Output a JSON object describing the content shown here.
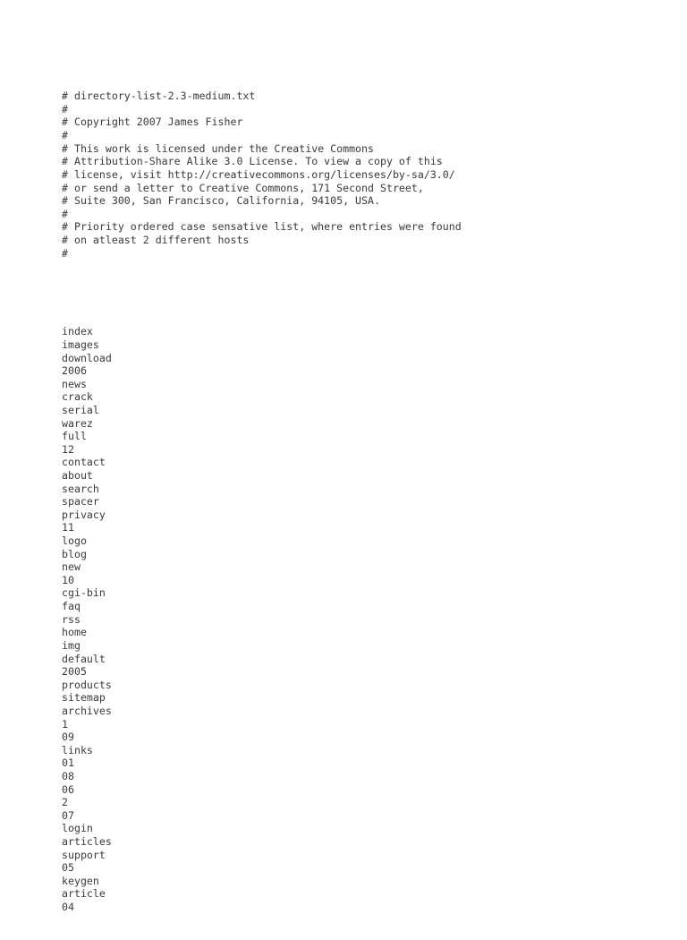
{
  "document": {
    "kind": "plain-text-file",
    "filename": "directory-list-2.3-medium.txt",
    "background_color": "#ffffff",
    "text_color": "#3a3a3a"
  },
  "header_comments": [
    "# directory-list-2.3-medium.txt",
    "#",
    "# Copyright 2007 James Fisher",
    "#",
    "# This work is licensed under the Creative Commons",
    "# Attribution-Share Alike 3.0 License. To view a copy of this",
    "# license, visit http://creativecommons.org/licenses/by-sa/3.0/",
    "# or send a letter to Creative Commons, 171 Second Street,",
    "# Suite 300, San Francisco, California, 94105, USA.",
    "#",
    "# Priority ordered case sensative list, where entries were found",
    "# on atleast 2 different hosts",
    "#"
  ],
  "separator_blank_lines": 1,
  "entries": [
    "index",
    "images",
    "download",
    "2006",
    "news",
    "crack",
    "serial",
    "warez",
    "full",
    "12",
    "contact",
    "about",
    "search",
    "spacer",
    "privacy",
    "11",
    "logo",
    "blog",
    "new",
    "10",
    "cgi-bin",
    "faq",
    "rss",
    "home",
    "img",
    "default",
    "2005",
    "products",
    "sitemap",
    "archives",
    "1",
    "09",
    "links",
    "01",
    "08",
    "06",
    "2",
    "07",
    "login",
    "articles",
    "support",
    "05",
    "keygen",
    "article",
    "04"
  ]
}
